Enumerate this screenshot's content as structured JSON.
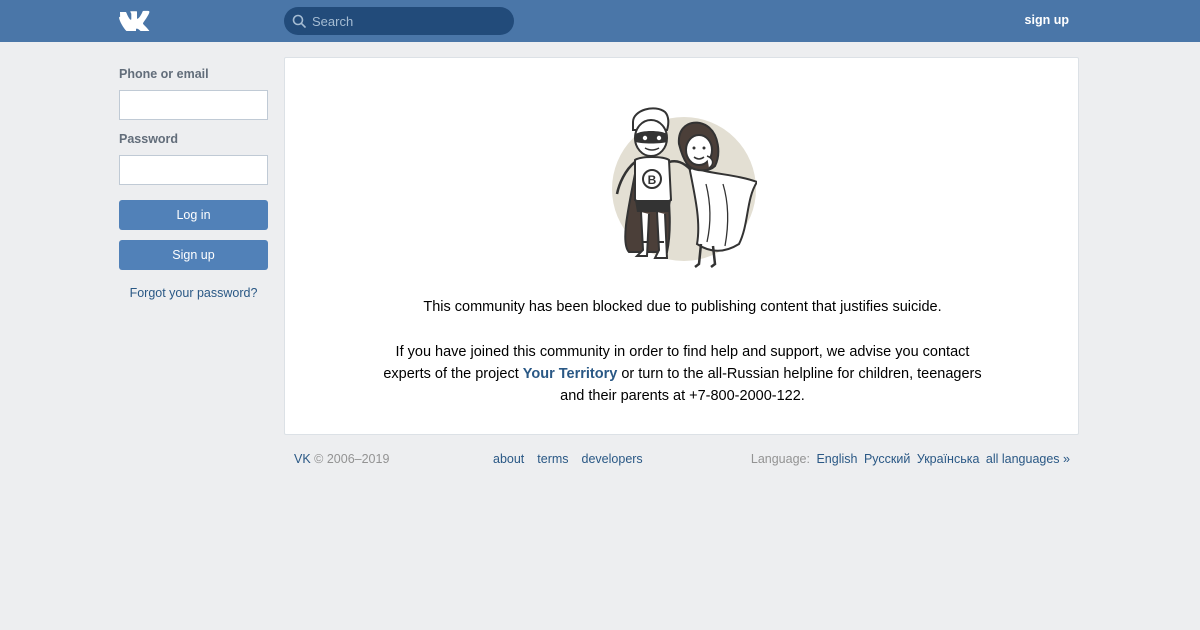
{
  "header": {
    "logo": "vk-logo",
    "search_placeholder": "Search",
    "signup_label": "sign up"
  },
  "sidebar": {
    "phone_label": "Phone or email",
    "password_label": "Password",
    "login_label": "Log in",
    "signup_label": "Sign up",
    "forgot_label": "Forgot your password?"
  },
  "main": {
    "illustration": "superhero-couple-illustration",
    "blocked_message": "This community has been blocked due to publishing content that justifies suicide.",
    "advice_part1": "If you have joined this community in order to find help and support, we advise you contact experts of the project ",
    "advice_link": "Your Territory",
    "advice_part2": " or turn to the all-Russian helpline for children, teenagers and their parents at +7-800-2000-122."
  },
  "footer": {
    "brand": "VK",
    "copyright": " © 2006–2019",
    "links": [
      "about",
      "terms",
      "developers"
    ],
    "language_label": "Language:",
    "languages": [
      "English",
      "Русский",
      "Українська",
      "all languages »"
    ]
  },
  "colors": {
    "header_bg": "#4a76a8",
    "button_bg": "#5181b8",
    "link": "#2a5885",
    "page_bg": "#edeef0"
  }
}
